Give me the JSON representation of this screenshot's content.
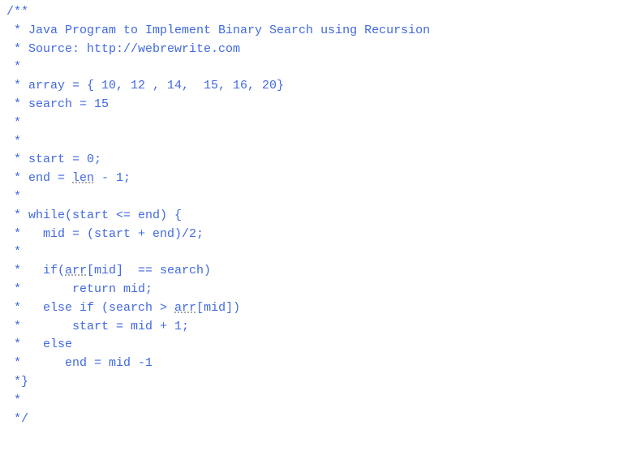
{
  "lines": [
    "/**",
    " * Java Program to Implement Binary Search using Recursion",
    " * Source: http://webrewrite.com",
    " *",
    " * array = { 10, 12 , 14,  15, 16, 20}",
    " * search = 15",
    " *",
    " *",
    " * start = 0;",
    " *",
    " * while(start <= end) {",
    " *   mid = (start + end)/2;",
    " *",
    " *       return mid;",
    " *       start = mid + 1;",
    " *   else",
    " *      end = mid -1",
    " *}",
    " *",
    " */"
  ],
  "endLine": {
    "prefix": " * end = ",
    "typo": "len",
    "suffix": " - 1;"
  },
  "ifLine": {
    "prefix": " *   if(",
    "typo": "arr",
    "mid": "[mid]  == search)"
  },
  "elseIfLine": {
    "prefix": " *   else if (search > ",
    "typo": "arr",
    "suffix": "[mid])"
  }
}
